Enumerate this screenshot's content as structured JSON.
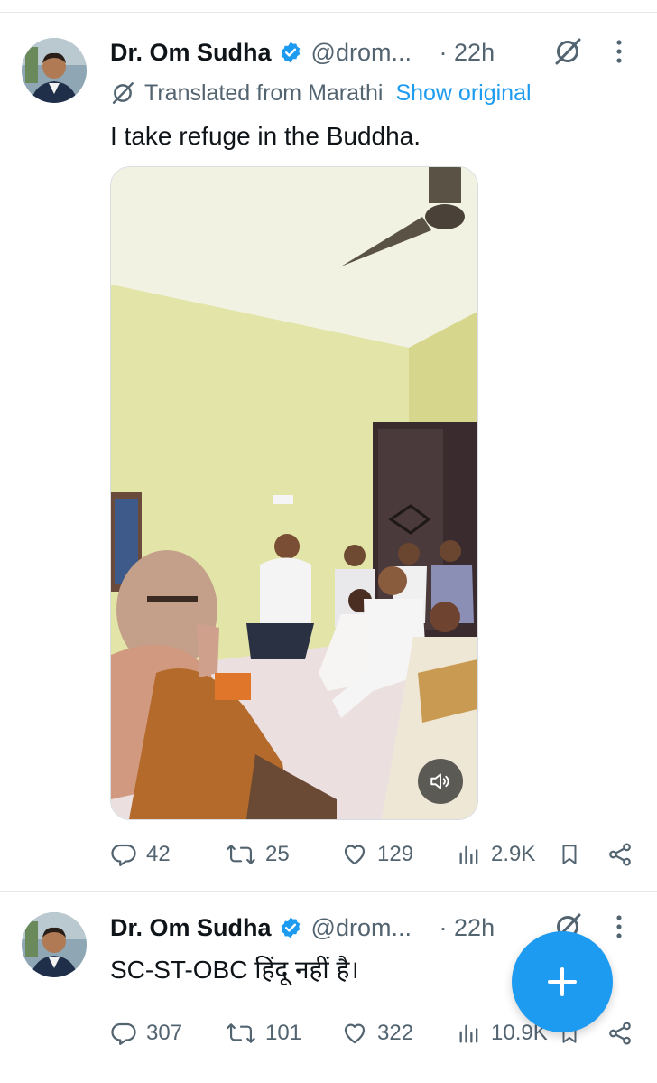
{
  "tweets": [
    {
      "author_name": "Dr. Om Sudha",
      "handle": "@drom...",
      "time": "· 22h",
      "translated_label": "Translated from Marathi",
      "show_original": "Show original",
      "text": "I take refuge in the Buddha.",
      "replies": "42",
      "reposts": "25",
      "likes": "129",
      "views": "2.9K"
    },
    {
      "author_name": "Dr. Om Sudha",
      "handle": "@drom...",
      "time": "· 22h",
      "text": "SC-ST-OBC हिंदू नहीं है।",
      "replies": "307",
      "reposts": "101",
      "likes": "322",
      "views": "10.9K"
    }
  ],
  "icons": {
    "verified": "verified-badge-icon",
    "grok": "grok-icon",
    "more": "more-vertical-icon",
    "reply": "reply-icon",
    "repost": "repost-icon",
    "like": "heart-icon",
    "views": "views-icon",
    "bookmark": "bookmark-icon",
    "share": "share-icon",
    "mute": "volume-icon",
    "compose": "plus-icon"
  },
  "colors": {
    "accent": "#1d9bf0",
    "secondary_text": "#536471",
    "primary_text": "#0f1419"
  }
}
